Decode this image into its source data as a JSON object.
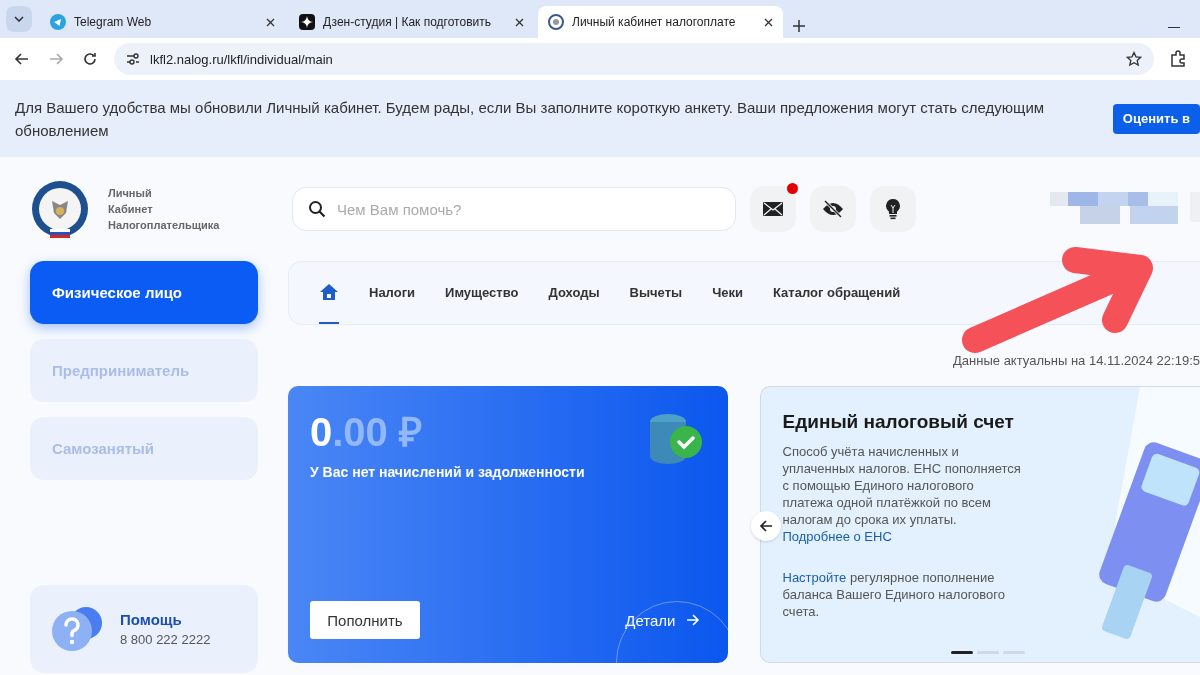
{
  "browser": {
    "tabs": [
      {
        "title": "Telegram Web",
        "selected": false
      },
      {
        "title": "Дзен-студия | Как подготовить",
        "selected": false
      },
      {
        "title": "Личный кабинет налогоплате",
        "selected": true
      }
    ],
    "address": "lkfl2.nalog.ru/lkfl/individual/main"
  },
  "banner": {
    "text": "Для Вашего удобства мы обновили Личный кабинет. Будем рады, если Вы заполните короткую анкету. Ваши предложения могут стать следующим обновлением",
    "button": "Оценить в"
  },
  "header": {
    "logo_lines": [
      "Личный",
      "Кабинет",
      "Налогоплательщика"
    ],
    "search_placeholder": "Чем Вам помочь?",
    "mail_unread": true
  },
  "sidebar": {
    "items": [
      {
        "label": "Физическое лицо",
        "selected": true
      },
      {
        "label": "Предприниматель",
        "selected": false
      },
      {
        "label": "Самозанятый",
        "selected": false
      }
    ],
    "help": {
      "title": "Помощь",
      "phone": "8 800 222 2222"
    }
  },
  "nav": {
    "items": [
      {
        "kind": "home",
        "selected": true
      },
      {
        "kind": "text",
        "label": "Налоги",
        "selected": false
      },
      {
        "kind": "text",
        "label": "Имущество",
        "selected": false
      },
      {
        "kind": "text",
        "label": "Доходы",
        "selected": false
      },
      {
        "kind": "text",
        "label": "Вычеты",
        "selected": false
      },
      {
        "kind": "text",
        "label": "Чеки",
        "selected": false
      },
      {
        "kind": "text",
        "label": "Каталог обращений",
        "selected": false
      }
    ]
  },
  "updated": "Данные актуальны на 14.11.2024 22:19:5",
  "balance_card": {
    "amount_whole": "0",
    "amount_rest": ".00 ₽",
    "message": "У Вас нет начислений и задолженности",
    "topup_button": "Пополнить",
    "details_link": "Детали"
  },
  "info_card": {
    "title": "Единый налоговый счет",
    "body": "Способ учёта начисленных и уплаченных налогов. ЕНС пополняется с помощью Единого налогового платежа одной платёжкой по всем налогам до срока их уплаты.",
    "body_link": "Подробнее о ЕНС",
    "setup_link": "Настройте",
    "setup_text": " регулярное пополнение баланса Вашего Единого налогового счета.",
    "dots": [
      {
        "selected": true
      },
      {
        "selected": false
      },
      {
        "selected": false
      }
    ]
  }
}
